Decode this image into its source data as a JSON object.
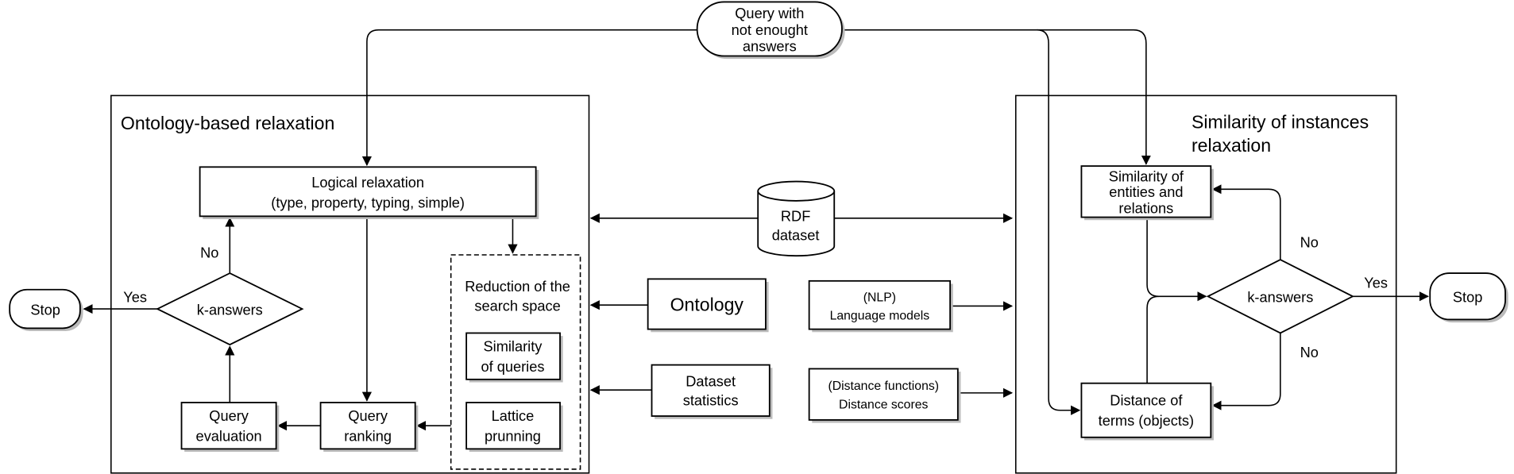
{
  "query": [
    "Query with",
    "not enought",
    "answers"
  ],
  "left_panel": {
    "title": "Ontology-based relaxation",
    "logical_relaxation": [
      "Logical relaxation",
      "(type, property, typing, simple)"
    ],
    "decision": "k-answers",
    "yes": "Yes",
    "no": "No",
    "stop": "Stop",
    "query_evaluation": [
      "Query",
      "evaluation"
    ],
    "query_ranking": [
      "Query",
      "ranking"
    ],
    "reduction": [
      "Reduction of the",
      "search space"
    ],
    "similarity_queries": [
      "Similarity",
      "of queries"
    ],
    "lattice": [
      "Lattice",
      "prunning"
    ]
  },
  "center": {
    "rdf": [
      "RDF",
      "dataset"
    ],
    "ontology": "Ontology",
    "dataset_statistics": [
      "Dataset",
      "statistics"
    ],
    "language_models": [
      "(NLP)",
      "Language models"
    ],
    "distance_scores": [
      "(Distance functions)",
      "Distance scores"
    ]
  },
  "right_panel": {
    "title": [
      "Similarity of instances",
      "relaxation"
    ],
    "similarity_entities": [
      "Similarity of",
      "entities and",
      "relations"
    ],
    "distance_terms": [
      "Distance of",
      "terms (objects)"
    ],
    "decision": "k-answers",
    "yes": "Yes",
    "no_top": "No",
    "no_bottom": "No",
    "stop": "Stop"
  }
}
